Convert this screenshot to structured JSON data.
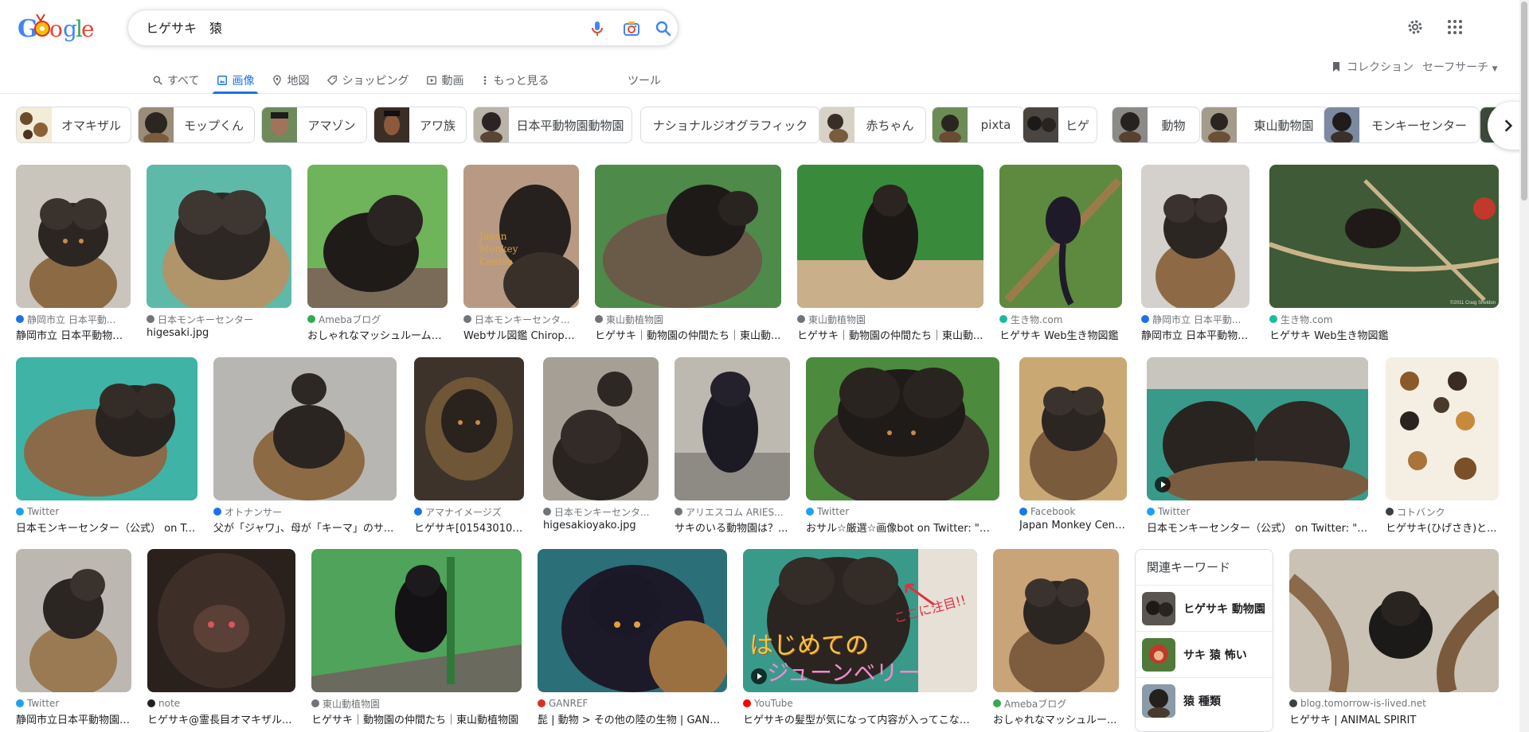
{
  "search": {
    "query": "ヒゲサキ　猿"
  },
  "tabs": [
    {
      "label": "すべて",
      "icon": "search-icon"
    },
    {
      "label": "画像",
      "icon": "image-icon",
      "active": true
    },
    {
      "label": "地図",
      "icon": "map-pin-icon"
    },
    {
      "label": "ショッピング",
      "icon": "tag-icon"
    },
    {
      "label": "動画",
      "icon": "video-icon"
    },
    {
      "label": "もっと見る",
      "icon": "more-vert-icon"
    }
  ],
  "tools_label": "ツール",
  "collection_label": "コレクション",
  "safesearch_label": "セーフサーチ",
  "chips": [
    {
      "label": "オマキザル"
    },
    {
      "label": "モップくん"
    },
    {
      "label": "アマゾン"
    },
    {
      "label": "アワ族"
    },
    {
      "label": "日本平動物園動物園"
    },
    {
      "label": "ナショナルジオグラフィック"
    },
    {
      "label": "赤ちゃん"
    },
    {
      "label": "pixta"
    },
    {
      "label": "ヒゲ"
    },
    {
      "label": "動物"
    },
    {
      "label": "東山動物園"
    },
    {
      "label": "モンキーセンター"
    }
  ],
  "results": [
    {
      "source": "静岡市立 日本平動...",
      "title": "静岡市立 日本平動物園...",
      "fav": "#1a73e8"
    },
    {
      "source": "日本モンキーセンター",
      "title": "higesaki.jpg",
      "fav": "#70757a"
    },
    {
      "source": "Amebaブログ",
      "title": "おしゃれなマッシュルーム頭...",
      "fav": "#34a853"
    },
    {
      "source": "日本モンキーセンタ...",
      "title": "Webサル図鑑 Chiropot...",
      "fav": "#70757a",
      "overlay": "Japan\nMonkey\nCentre"
    },
    {
      "source": "東山動植物園",
      "title": "ヒゲサキ｜動物園の仲間たち｜東山動...",
      "fav": "#70757a"
    },
    {
      "source": "東山動植物園",
      "title": "ヒゲサキ｜動物園の仲間たち｜東山動...",
      "fav": "#70757a"
    },
    {
      "source": "生き物.com",
      "title": "ヒゲサキ Web生き物図鑑",
      "fav": "#1abc9c"
    },
    {
      "source": "静岡市立 日本平動...",
      "title": "静岡市立 日本平動物園...",
      "fav": "#1a73e8"
    },
    {
      "source": "生き物.com",
      "title": "ヒゲサキ Web生き物図鑑",
      "fav": "#1abc9c"
    },
    {
      "source": "Twitter",
      "title": "日本モンキーセンター（公式） on Twi...",
      "fav": "#1da1f2"
    },
    {
      "source": "オトナンサー",
      "title": "父が「ジャワ」、母が「キーマ」のサ...",
      "fav": "#1a73e8"
    },
    {
      "source": "アマナイメージズ",
      "title": "ヒゲサキ[01543010452...",
      "fav": "#1a73e8"
    },
    {
      "source": "日本モンキーセンタ...",
      "title": "higesakioyako.jpg",
      "fav": "#70757a"
    },
    {
      "source": "アリエスコム ARIES...",
      "title": "サキのいる動物園は？...",
      "fav": "#70757a"
    },
    {
      "source": "Twitter",
      "title": "おサル☆厳選☆画像bot on Twitter: \"ヒゲ...",
      "fav": "#1da1f2"
    },
    {
      "source": "Facebook",
      "title": "Japan Monkey Centre -...",
      "fav": "#1877f2"
    },
    {
      "source": "Twitter",
      "title": "日本モンキーセンター（公式） on Twitter: \"ク...",
      "fav": "#1da1f2"
    },
    {
      "source": "コトバンク",
      "title": "ヒゲサキ(ひげさき)と...",
      "fav": "#3c4043"
    },
    {
      "source": "Twitter",
      "title": "静岡市立日本平動物園 ...",
      "fav": "#1da1f2"
    },
    {
      "source": "note",
      "title": "ヒゲサキ@霊長目オマキザル...",
      "fav": "#202124"
    },
    {
      "source": "東山動植物園",
      "title": "ヒゲサキ｜動物園の仲間たち｜東山動植物園",
      "fav": "#70757a"
    },
    {
      "source": "GANREF",
      "title": "髭 | 動物 > その他の陸の生物 | GANREF",
      "fav": "#d93025"
    },
    {
      "source": "YouTube",
      "title": "ヒゲサキの髪型が気になって内容が入ってこない...",
      "fav": "#ff0000",
      "overlay1": "はじめての",
      "overlay2": "ジューンベリー",
      "overlay3": "ここに注目!!"
    },
    {
      "source": "Amebaブログ",
      "title": "おしゃれなマッシュルー...",
      "fav": "#34a853"
    },
    {
      "source": "blog.tomorrow-is-lived.net",
      "title": "ヒゲサキ | ANIMAL SPIRIT",
      "fav": "#3c4043"
    }
  ],
  "watermark": "©2011 Craig Sheldon",
  "related": {
    "heading": "関連キーワード",
    "items": [
      {
        "label": "ヒゲサキ 動物園"
      },
      {
        "label": "サキ 猿 怖い"
      },
      {
        "label": "猿 種類"
      }
    ]
  },
  "colors": {
    "accent": "#1a73e8",
    "text": "#202124",
    "muted": "#70757a"
  }
}
